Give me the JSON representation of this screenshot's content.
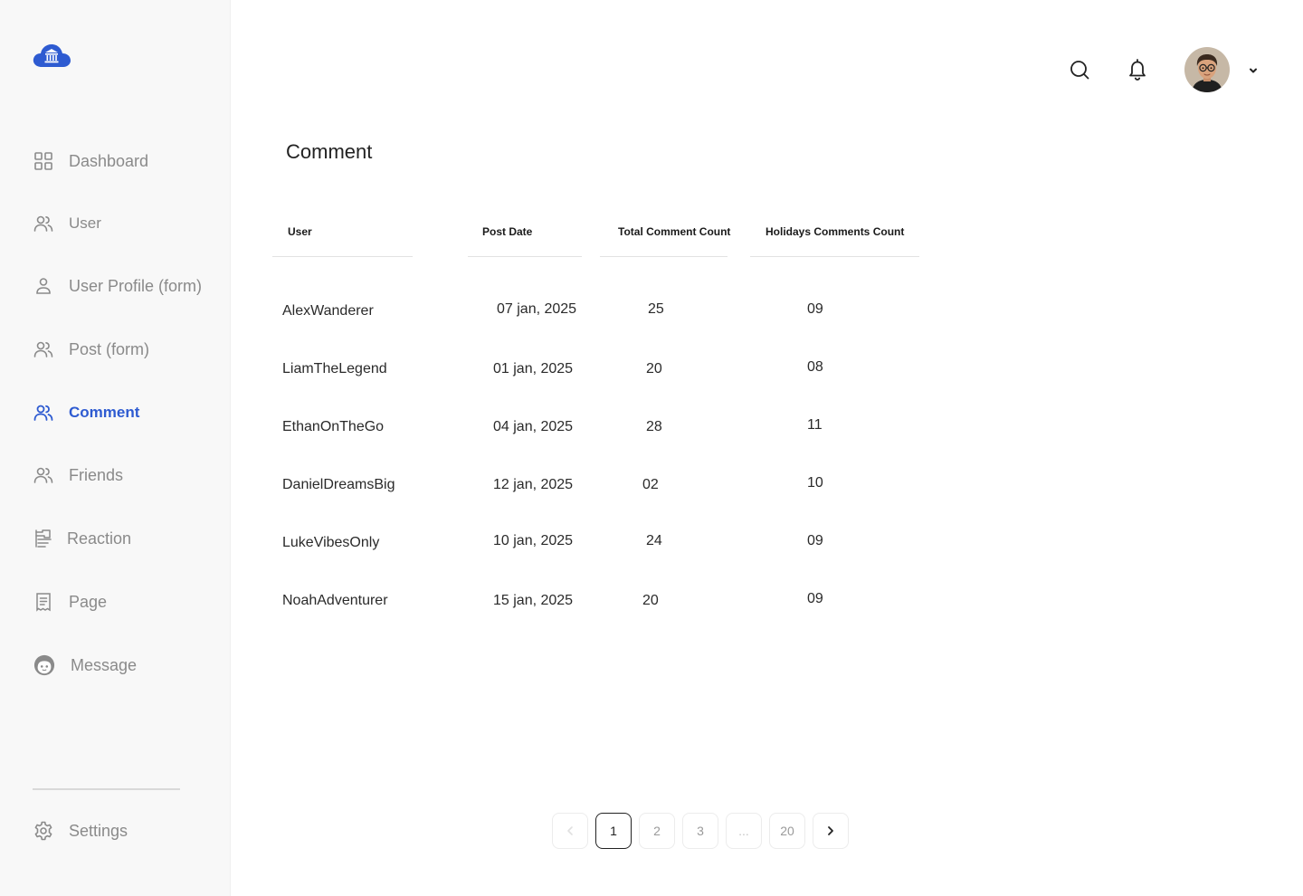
{
  "sidebar": {
    "items": [
      {
        "label": "Dashboard",
        "icon": "grid-icon"
      },
      {
        "label": "User",
        "icon": "users-icon"
      },
      {
        "label": "User Profile (form)",
        "icon": "user-icon"
      },
      {
        "label": "Post (form)",
        "icon": "users-icon"
      },
      {
        "label": "Comment",
        "icon": "users-icon",
        "active": true
      },
      {
        "label": "Friends",
        "icon": "users-icon"
      },
      {
        "label": "Reaction",
        "icon": "reaction-icon"
      },
      {
        "label": "Page",
        "icon": "document-icon"
      },
      {
        "label": "Message",
        "icon": "face-icon"
      }
    ],
    "settings_label": "Settings"
  },
  "colors": {
    "accent": "#2e5bd1",
    "muted": "#8a8a8a"
  },
  "main": {
    "title": "Comment",
    "table": {
      "columns": [
        "User",
        "Post Date",
        "Total Comment Count",
        "Holidays Comments Count"
      ],
      "rows": [
        {
          "user": "AlexWanderer",
          "date": "07 jan, 2025",
          "total": "25",
          "holidays": "09"
        },
        {
          "user": "LiamTheLegend",
          "date": "01 jan, 2025",
          "total": "20",
          "holidays": "08"
        },
        {
          "user": "EthanOnTheGo",
          "date": "04 jan, 2025",
          "total": "28",
          "holidays": "11"
        },
        {
          "user": "DanielDreamsBig",
          "date": "12 jan, 2025",
          "total": "02",
          "holidays": "10"
        },
        {
          "user": "LukeVibesOnly",
          "date": "10 jan, 2025",
          "total": "24",
          "holidays": "09"
        },
        {
          "user": "NoahAdventurer",
          "date": "15 jan, 2025",
          "total": "20",
          "holidays": "09"
        }
      ]
    },
    "pagination": {
      "pages": [
        "1",
        "2",
        "3",
        "...",
        "20"
      ],
      "current": "1"
    }
  }
}
